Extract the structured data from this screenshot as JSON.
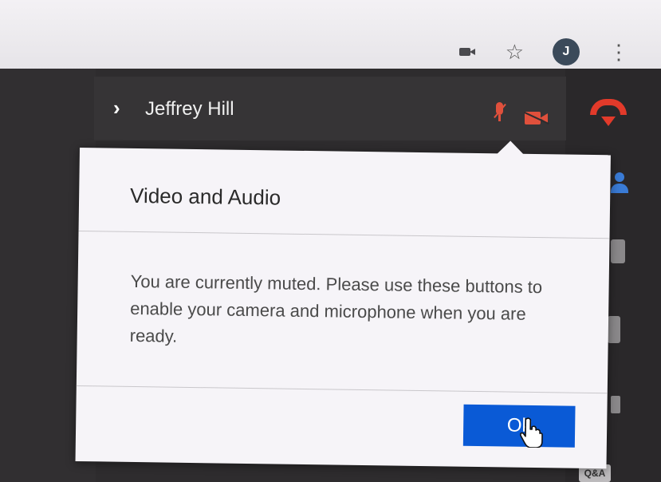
{
  "browser": {
    "avatar_initial": "J",
    "icons": [
      "video-camera-icon",
      "star-icon",
      "kebab-menu-icon"
    ]
  },
  "call": {
    "participant_name": "Jeffrey Hill",
    "mic_status": "muted",
    "camera_status": "off",
    "side_badge": "Q&A"
  },
  "dialog": {
    "title": "Video and Audio",
    "message": "You are currently muted. Please use these buttons to enable your camera and microphone when you are ready.",
    "ok_label": "Ok"
  },
  "colors": {
    "accent_blue": "#0a5ad6",
    "muted_red": "#e0503c",
    "hangup_red": "#e23a2a"
  }
}
